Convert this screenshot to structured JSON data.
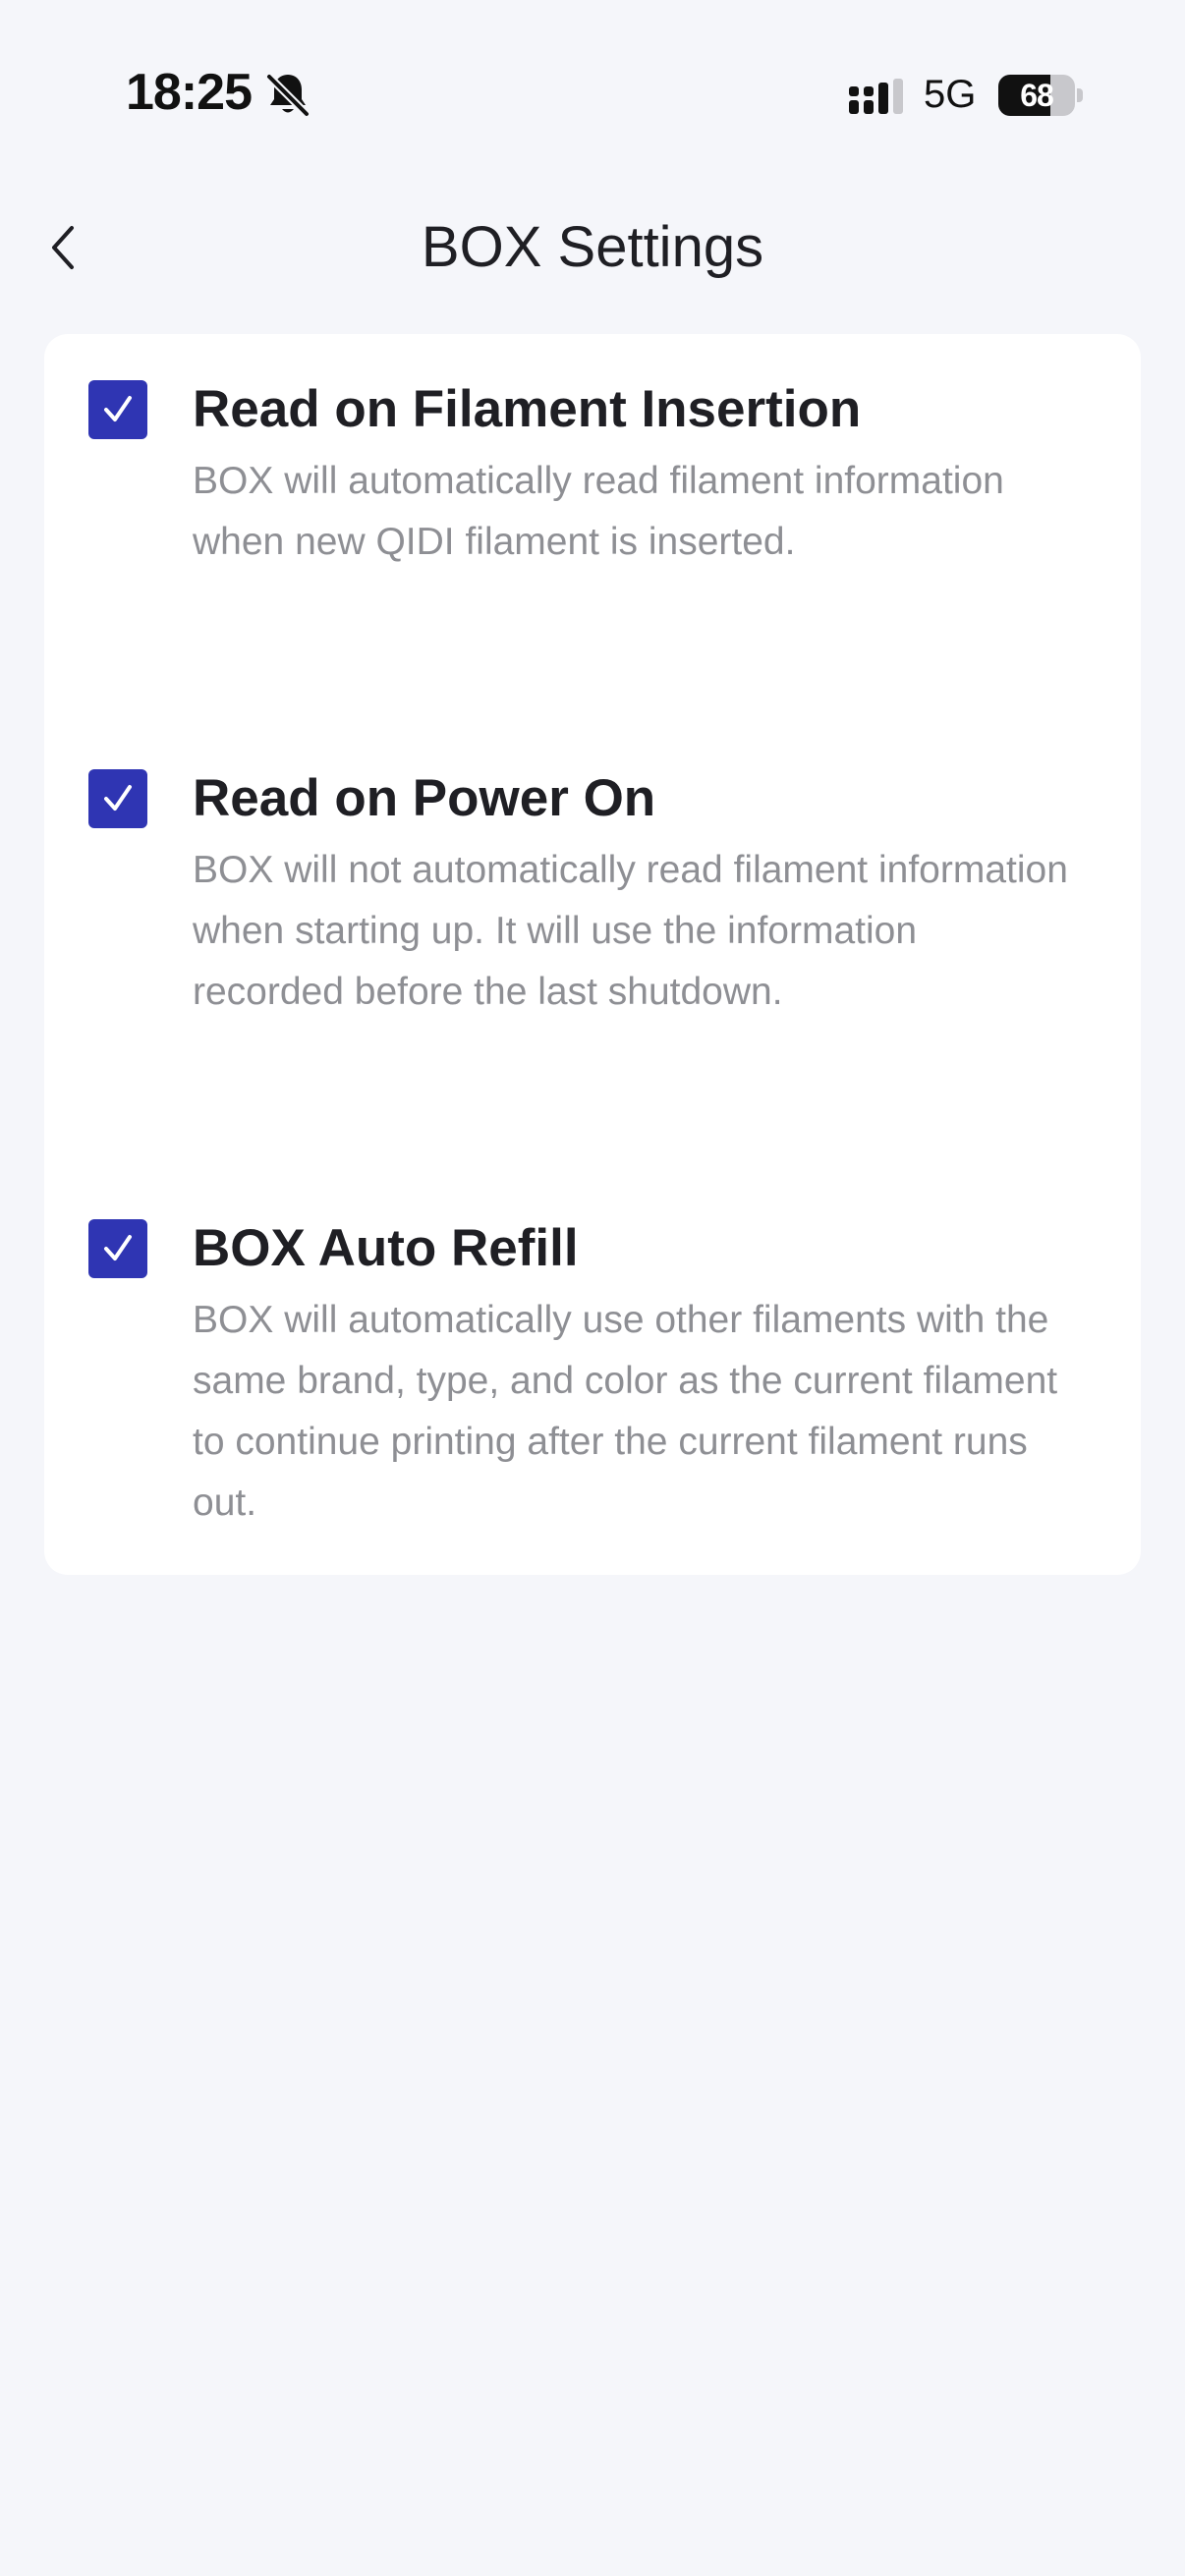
{
  "status_bar": {
    "time": "18:25",
    "network": "5G",
    "battery_level": "68",
    "battery_fraction": 0.68,
    "icons": [
      "bell-slash-icon",
      "cellular-signal-icon",
      "battery-icon"
    ]
  },
  "nav": {
    "back_icon": "chevron-left-icon",
    "title": "BOX Settings"
  },
  "settings": [
    {
      "title": "Read on Filament Insertion",
      "description": "BOX will automatically read filament information when new QIDI filament is inserted.",
      "checked": true
    },
    {
      "title": "Read on Power On",
      "description": "BOX will not automatically read filament information when starting up. It will use the information recorded before the last shutdown.",
      "checked": true
    },
    {
      "title": "BOX Auto Refill",
      "description": "BOX will automatically use other filaments with the same brand, type, and color as the current filament to continue printing after the current filament runs out.",
      "checked": true
    }
  ],
  "colors": {
    "accent": "#2f35b3",
    "background": "#f5f6fa",
    "card": "#ffffff",
    "title_text": "#1f1f24",
    "description_text": "#8e8f94"
  }
}
